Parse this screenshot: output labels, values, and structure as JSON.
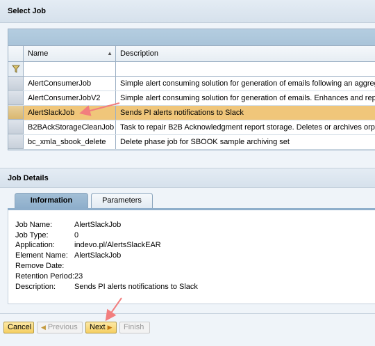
{
  "select_job": {
    "title": "Select Job",
    "columns": {
      "name": "Name",
      "description": "Description"
    },
    "rows": [
      {
        "name": "AlertConsumerJob",
        "description": "Simple alert consuming solution for generation of emails following an aggreg"
      },
      {
        "name": "AlertConsumerJobV2",
        "description": "Simple alert consuming solution for generation of emails. Enhances and repla"
      },
      {
        "name": "AlertSlackJob",
        "description": "Sends PI alerts notifications to Slack",
        "selected": true
      },
      {
        "name": "B2BAckStorageCleanJob",
        "description": "Task to repair B2B Acknowledgment report storage. Deletes or archives orp"
      },
      {
        "name": "bc_xmla_sbook_delete",
        "description": "Delete phase job for SBOOK sample archiving set"
      }
    ]
  },
  "job_details": {
    "title": "Job Details",
    "tabs": {
      "information": "Information",
      "parameters": "Parameters"
    },
    "fields": {
      "job_name": {
        "label": "Job Name:",
        "value": "AlertSlackJob"
      },
      "job_type": {
        "label": "Job Type:",
        "value": "0"
      },
      "application": {
        "label": "Application:",
        "value": "indevo.pl/AlertsSlackEAR"
      },
      "element_name": {
        "label": "Element Name:",
        "value": "AlertSlackJob"
      },
      "remove_date": {
        "label": "Remove Date:",
        "value": ""
      },
      "retention_period": {
        "label": "Retention Period:",
        "value": "23"
      },
      "description": {
        "label": "Description:",
        "value": "Sends PI alerts notifications to Slack"
      }
    }
  },
  "footer": {
    "cancel": "Cancel",
    "previous": "Previous",
    "next": "Next",
    "finish": "Finish"
  },
  "colors": {
    "selected_row": "#f0c67a",
    "annotation_arrow": "#f27e7e",
    "button_bg": "#f5cf62"
  }
}
